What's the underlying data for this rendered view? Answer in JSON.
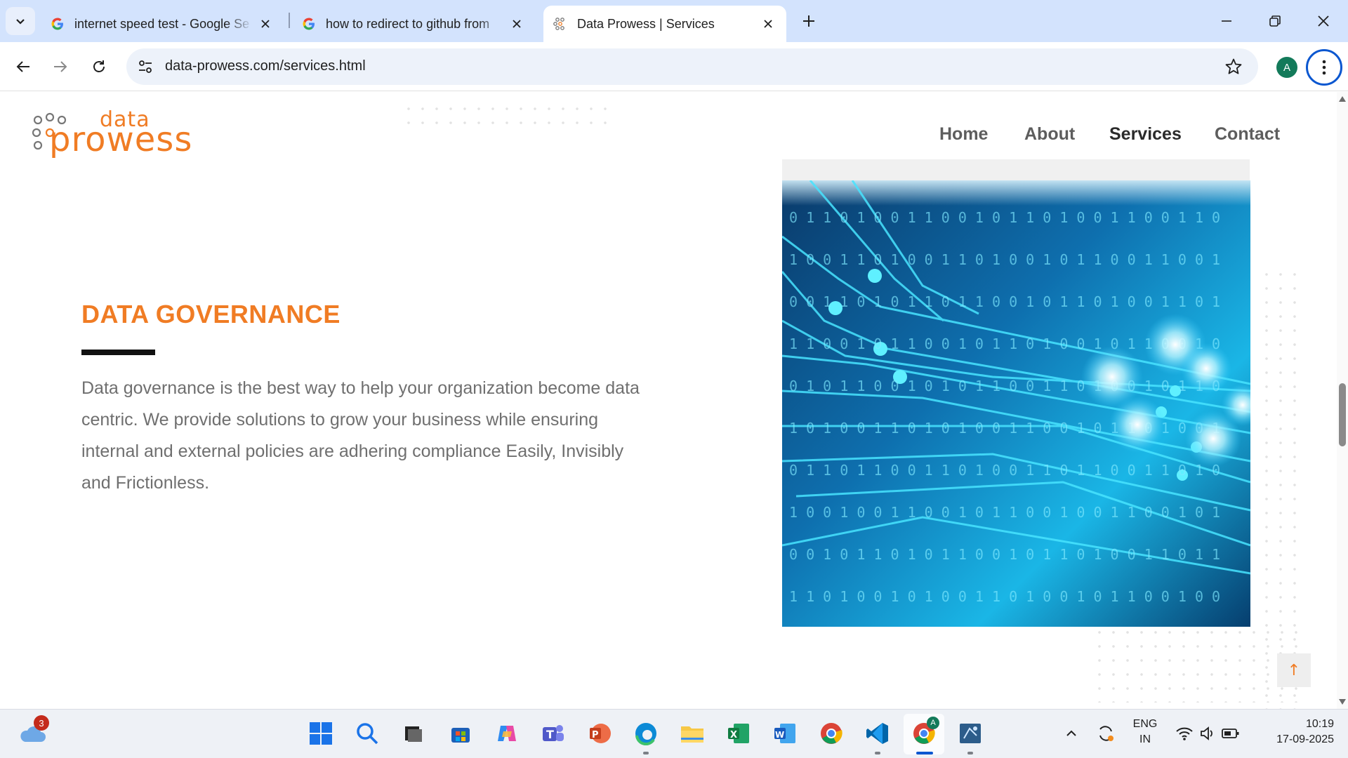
{
  "browser": {
    "tabs": [
      {
        "title": "internet speed test - Google Se",
        "icon": "google-icon"
      },
      {
        "title": "how to redirect to github from",
        "icon": "google-icon"
      },
      {
        "title": "Data Prowess | Services",
        "icon": "data-prowess-favicon"
      }
    ],
    "url": "data-prowess.com/services.html",
    "profile_initial": "A"
  },
  "site": {
    "logo_small": "data",
    "logo_big": "prowess",
    "nav": [
      "Home",
      "About",
      "Services",
      "Contact"
    ],
    "section_title": "DATA GOVERNANCE",
    "section_body": "Data governance is the best way to help your organization become data centric. We provide solutions to grow your business while ensuring internal and external policies are adhering compliance Easily, Invisibly and Frictionless.",
    "back_to_top": "↑"
  },
  "taskbar": {
    "weather_badge": "3",
    "language_line1": "ENG",
    "language_line2": "IN",
    "time": "10:19",
    "date": "17-09-2025",
    "chrome_profile_badge": "A"
  },
  "colors": {
    "brand_orange": "#f07c24",
    "chrome_blue": "#d3e3fd",
    "accent_blue": "#0b57d0"
  }
}
